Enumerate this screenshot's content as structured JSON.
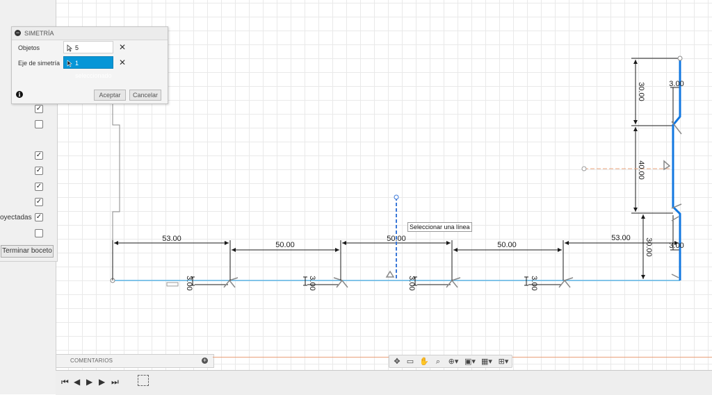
{
  "symmetry_dialog": {
    "title": "SIMETRÍA",
    "objects_label": "Objetos",
    "objects_value": "5 seleccionado",
    "axis_label": "Eje de simetría",
    "axis_value": "1 seleccionado",
    "ok_label": "Aceptar",
    "cancel_label": "Cancelar"
  },
  "browser": {
    "projected_label": "oyectadas",
    "checkboxes": [
      true,
      false,
      true,
      true,
      true,
      true,
      true,
      false
    ],
    "finish_sketch_label": "Terminar boceto"
  },
  "canvas": {
    "tooltip": "Seleccionar una línea",
    "dimensions": {
      "h1": "53.00",
      "h2": "50.00",
      "h3": "50.00",
      "h4": "50.00",
      "h5": "53.00",
      "notch1": "3.00",
      "notch2": "3.00",
      "notch3": "3.00",
      "notch4": "3.00",
      "v_top": "30.00",
      "v_mid": "40.00",
      "v_bot": "30.00",
      "notch_r1": "3.00",
      "notch_r2": "3.00"
    },
    "colors": {
      "sketch_line": "#5bb4e6",
      "selected_line": "#1177e0",
      "axis_line": "#3a78d8",
      "dimension": "#1a1a1a",
      "construction": "#e8a078"
    }
  },
  "comments": {
    "label": "COMENTARIOS"
  },
  "nav_toolbar": {
    "icons": [
      "orbit-icon",
      "look-at-icon",
      "pan-icon",
      "zoom-icon",
      "fit-icon",
      "display-icon",
      "grid-icon",
      "viewports-icon"
    ]
  },
  "playback": {
    "icons": [
      "first-icon",
      "prev-icon",
      "play-icon",
      "next-icon",
      "last-icon"
    ]
  }
}
